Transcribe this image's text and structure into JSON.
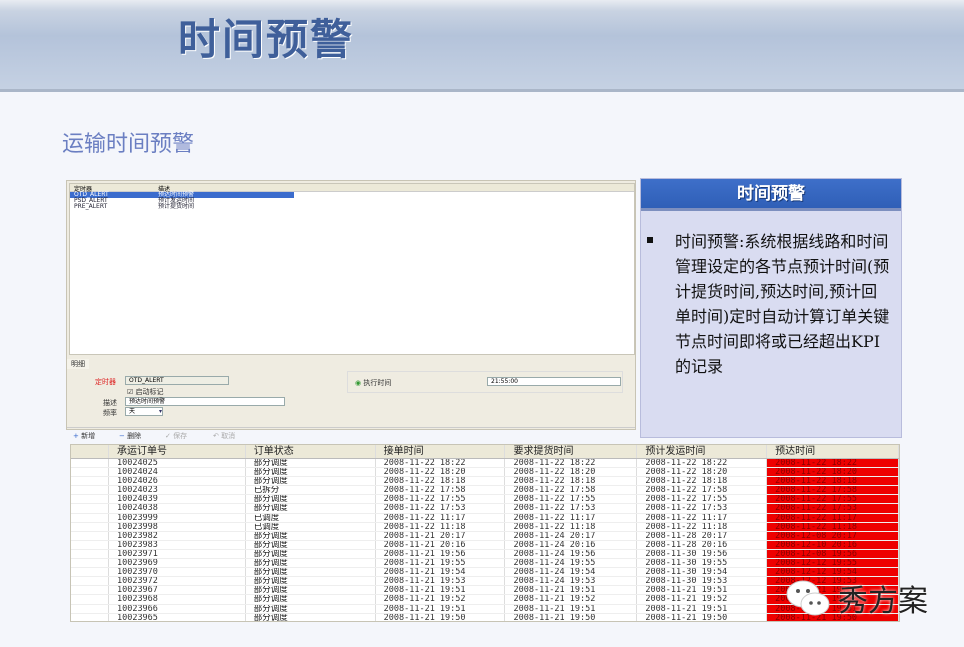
{
  "slide": {
    "title": "时间预警",
    "subtitle": "运输时间预警"
  },
  "app": {
    "list_headers": [
      "定时器",
      "描述"
    ],
    "list_rows": [
      [
        "OTD_ALERT",
        "预达时间预警"
      ],
      [
        "PSD_ALERT",
        "预计发运时间"
      ],
      [
        "PRE_ALERT",
        "预计提货时间"
      ]
    ],
    "tab_label": "明细",
    "timer_label": "定时器",
    "timer_value": "OTD_ALERT",
    "enable_label": "启动标记",
    "desc_label": "描述",
    "desc_value": "预达时间预警",
    "freq_label": "频率",
    "freq_value": "天",
    "exec_label": "执行时间",
    "exec_value": "21:55:00",
    "buttons": {
      "add": "新增",
      "delete": "删除",
      "save": "保存",
      "cancel": "取消"
    }
  },
  "side": {
    "header": "时间预警",
    "text": "时间预警:系统根据线路和时间管理设定的各节点预计时间(预计提货时间,预达时间,预计回单时间)定时自动计算订单关键节点时间即将或已经超出KPI的记录",
    "dot": "."
  },
  "table": {
    "headers": [
      "",
      "承运订单号",
      "订单状态",
      "接单时间",
      "要求提货时间",
      "预计发运时间",
      "预达时间"
    ],
    "rows": [
      [
        "10024025",
        "部分调度",
        "2008-11-22  18:22",
        "2008-11-22  18:22",
        "2008-11-22  18:22",
        "2008-11-22  18:22"
      ],
      [
        "10024024",
        "部分调度",
        "2008-11-22  18:20",
        "2008-11-22  18:20",
        "2008-11-22  18:20",
        "2008-11-22  18:20"
      ],
      [
        "10024026",
        "部分调度",
        "2008-11-22  18:18",
        "2008-11-22  18:18",
        "2008-11-22  18:18",
        "2008-11-22  18:18"
      ],
      [
        "10024023",
        "已拆分",
        "2008-11-22  17:58",
        "2008-11-22  17:58",
        "2008-11-22  17:58",
        "2008-11-22  17:58"
      ],
      [
        "10024039",
        "部分调度",
        "2008-11-22  17:55",
        "2008-11-22  17:55",
        "2008-11-22  17:55",
        "2008-11-22  17:55"
      ],
      [
        "10024038",
        "部分调度",
        "2008-11-22  17:53",
        "2008-11-22  17:53",
        "2008-11-22  17:53",
        "2008-11-22  17:53"
      ],
      [
        "10023999",
        "已调度",
        "2008-11-22  11:17",
        "2008-11-22  11:17",
        "2008-11-22  11:17",
        "2008-11-22  11:17"
      ],
      [
        "10023998",
        "已调度",
        "2008-11-22  11:18",
        "2008-11-22  11:18",
        "2008-11-22  11:18",
        "2008-11-22  11:18"
      ],
      [
        "10023982",
        "部分调度",
        "2008-11-21  20:17",
        "2008-11-24  20:17",
        "2008-11-28  20:17",
        "2008-12-08  20:17"
      ],
      [
        "10023983",
        "部分调度",
        "2008-11-21  20:16",
        "2008-11-24  20:16",
        "2008-11-28  20:16",
        "2008-12-10  20:16"
      ],
      [
        "10023971",
        "部分调度",
        "2008-11-21  19:56",
        "2008-11-24  19:56",
        "2008-11-30  19:56",
        "2008-12-08  19:56"
      ],
      [
        "10023969",
        "部分调度",
        "2008-11-21  19:55",
        "2008-11-24  19:55",
        "2008-11-30  19:55",
        "2008-12-12  19:55"
      ],
      [
        "10023970",
        "部分调度",
        "2008-11-21  19:54",
        "2008-11-24  19:54",
        "2008-11-30  19:54",
        "2008-12-12  19:54"
      ],
      [
        "10023972",
        "部分调度",
        "2008-11-21  19:53",
        "2008-11-24  19:53",
        "2008-11-30  19:53",
        "2008-12-12  19:53"
      ],
      [
        "10023967",
        "部分调度",
        "2008-11-21  19:51",
        "2008-11-21  19:51",
        "2008-11-21  19:51",
        "2008-11-21  19:51"
      ],
      [
        "10023968",
        "部分调度",
        "2008-11-21  19:52",
        "2008-11-21  19:52",
        "2008-11-21  19:52",
        "2008-11-21  19:52"
      ],
      [
        "10023966",
        "部分调度",
        "2008-11-21  19:51",
        "2008-11-21  19:51",
        "2008-11-21  19:51",
        "2008-11-21  19:51"
      ],
      [
        "10023965",
        "部分调度",
        "2008-11-21  19:50",
        "2008-11-21  19:50",
        "2008-11-21  19:50",
        "2008-11-21  19:50"
      ]
    ]
  },
  "watermark": "秀方案",
  "colors": {
    "alert": "#e00000",
    "header_blue": "#3e6fc9"
  }
}
